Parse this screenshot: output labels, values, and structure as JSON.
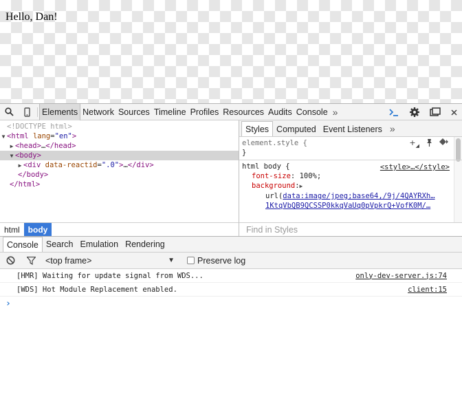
{
  "page": {
    "greeting": "Hello, Dan!"
  },
  "toolbar": {
    "tabs": [
      "Elements",
      "Network",
      "Sources",
      "Timeline",
      "Profiles",
      "Resources",
      "Audits",
      "Console"
    ],
    "active_tab": "Elements",
    "more": "»"
  },
  "elements": {
    "doctype": "<!DOCTYPE html>",
    "html_open_tag": "<html",
    "html_attr_name": "lang",
    "html_attr_value": "\"en\"",
    "head_text": "<head>",
    "head_ellipsis": "…",
    "head_close": "</head>",
    "body_open": "<body>",
    "div_open": "<div",
    "div_attr_name": "data-reactid",
    "div_attr_value": "\".0\"",
    "div_gt": ">",
    "div_ellipsis": "…",
    "div_close": "</div>",
    "body_close": "</body>",
    "html_close": "</html>",
    "eq": "=",
    "gt": ">"
  },
  "breadcrumbs": [
    "html",
    "body"
  ],
  "styles": {
    "tabs": [
      "Styles",
      "Computed",
      "Event Listeners"
    ],
    "active_tab": "Styles",
    "more": "»",
    "element_style_selector": "element.style {",
    "close_brace": "}",
    "rule_selector": "html body {",
    "rule_source": "<style>…</style>",
    "prop1_name": "font-size",
    "prop1_value": "100%;",
    "prop2_name": "background",
    "url_prefix": "url(",
    "url_line1": "data:image/jpeg;base64,/9j/4QAYRXh…",
    "url_line2": "1KtqVbQB9QCSSP0kkqVaUq0pVpkrQ+VofK0M/…",
    "find_placeholder": "Find in Styles"
  },
  "drawer": {
    "tabs": [
      "Console",
      "Search",
      "Emulation",
      "Rendering"
    ],
    "active_tab": "Console"
  },
  "console": {
    "frame": "<top frame>",
    "preserve_log": "Preserve log",
    "messages": [
      {
        "text": "[HMR] Waiting for update signal from WDS...",
        "source": "only-dev-server.js:74"
      },
      {
        "text": "[WDS] Hot Module Replacement enabled.",
        "source": "client:15"
      }
    ],
    "prompt": "›"
  },
  "icons": [
    "search-icon",
    "device-mode-icon",
    "console-drawer-icon",
    "settings-gear-icon",
    "dock-side-icon",
    "close-icon",
    "clear-console-icon",
    "filter-icon",
    "new-style-rule-icon",
    "toggle-element-state-icon",
    "color-format-icon"
  ]
}
